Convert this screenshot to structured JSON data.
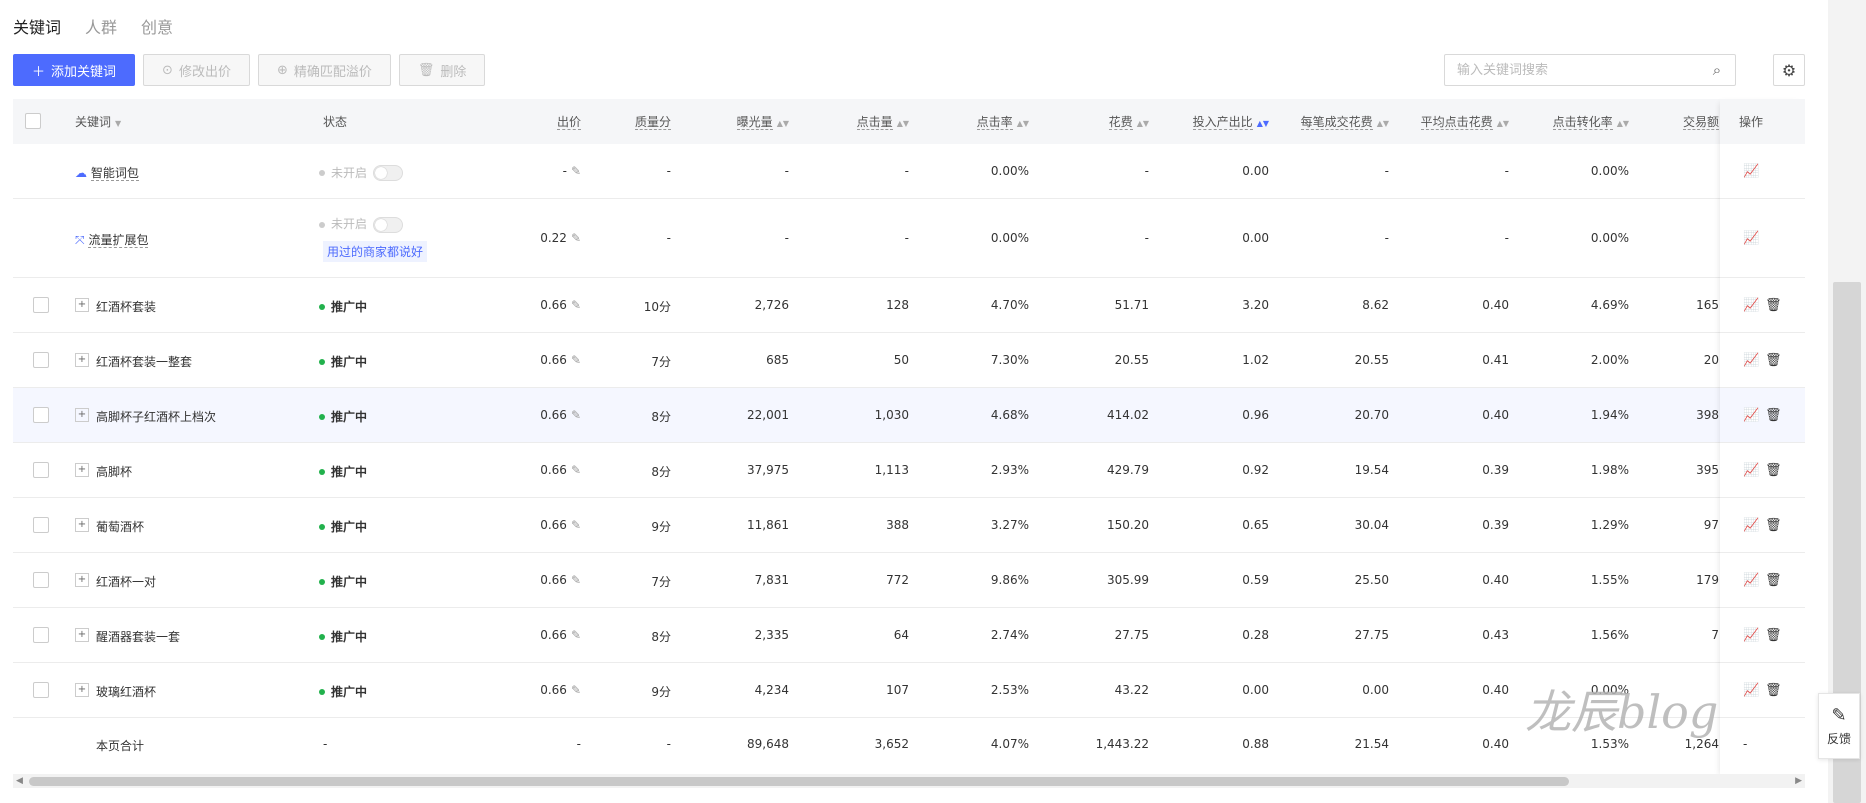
{
  "tabs": [
    "关键词",
    "人群",
    "创意"
  ],
  "toolbar": {
    "add_label": "添加关键词",
    "edit_bid_label": "修改出价",
    "exact_match_label": "精确匹配溢价",
    "delete_label": "删除"
  },
  "search": {
    "placeholder": "输入关键词搜索"
  },
  "headers": {
    "keyword": "关键词",
    "status": "状态",
    "bid": "出价",
    "quality": "质量分",
    "impressions": "曝光量",
    "clicks": "点击量",
    "ctr": "点击率",
    "cost": "花费",
    "roi": "投入产出比",
    "cost_per_order": "每笔成交花费",
    "avg_cpc": "平均点击花费",
    "cvr": "点击转化率",
    "gmv": "交易额",
    "ops": "操作"
  },
  "special_rows": [
    {
      "name": "智能词包",
      "status": "未开启",
      "bid": "-",
      "quality": "-",
      "impressions": "-",
      "clicks": "-",
      "ctr": "0.00%",
      "cost": "-",
      "roi": "0.00",
      "cost_per_order": "-",
      "avg_cpc": "-",
      "cvr": "0.00%"
    },
    {
      "name": "流量扩展包",
      "status": "未开启",
      "tip": "用过的商家都说好",
      "bid": "0.22",
      "quality": "-",
      "impressions": "-",
      "clicks": "-",
      "ctr": "0.00%",
      "cost": "-",
      "roi": "0.00",
      "cost_per_order": "-",
      "avg_cpc": "-",
      "cvr": "0.00%"
    }
  ],
  "rows": [
    {
      "keyword": "红酒杯套装",
      "status": "推广中",
      "bid": "0.66",
      "quality": "10分",
      "impressions": "2,726",
      "clicks": "128",
      "ctr": "4.70%",
      "cost": "51.71",
      "roi": "3.20",
      "cost_per_order": "8.62",
      "avg_cpc": "0.40",
      "cvr": "4.69%",
      "gmv": "165"
    },
    {
      "keyword": "红酒杯套装一整套",
      "status": "推广中",
      "bid": "0.66",
      "quality": "7分",
      "impressions": "685",
      "clicks": "50",
      "ctr": "7.30%",
      "cost": "20.55",
      "roi": "1.02",
      "cost_per_order": "20.55",
      "avg_cpc": "0.41",
      "cvr": "2.00%",
      "gmv": "20"
    },
    {
      "keyword": "高脚杯子红酒杯上档次",
      "status": "推广中",
      "bid": "0.66",
      "quality": "8分",
      "impressions": "22,001",
      "clicks": "1,030",
      "ctr": "4.68%",
      "cost": "414.02",
      "roi": "0.96",
      "cost_per_order": "20.70",
      "avg_cpc": "0.40",
      "cvr": "1.94%",
      "gmv": "398"
    },
    {
      "keyword": "高脚杯",
      "status": "推广中",
      "bid": "0.66",
      "quality": "8分",
      "impressions": "37,975",
      "clicks": "1,113",
      "ctr": "2.93%",
      "cost": "429.79",
      "roi": "0.92",
      "cost_per_order": "19.54",
      "avg_cpc": "0.39",
      "cvr": "1.98%",
      "gmv": "395"
    },
    {
      "keyword": "葡萄酒杯",
      "status": "推广中",
      "bid": "0.66",
      "quality": "9分",
      "impressions": "11,861",
      "clicks": "388",
      "ctr": "3.27%",
      "cost": "150.20",
      "roi": "0.65",
      "cost_per_order": "30.04",
      "avg_cpc": "0.39",
      "cvr": "1.29%",
      "gmv": "97"
    },
    {
      "keyword": "红酒杯一对",
      "status": "推广中",
      "bid": "0.66",
      "quality": "7分",
      "impressions": "7,831",
      "clicks": "772",
      "ctr": "9.86%",
      "cost": "305.99",
      "roi": "0.59",
      "cost_per_order": "25.50",
      "avg_cpc": "0.40",
      "cvr": "1.55%",
      "gmv": "179"
    },
    {
      "keyword": "醒酒器套装一套",
      "status": "推广中",
      "bid": "0.66",
      "quality": "8分",
      "impressions": "2,335",
      "clicks": "64",
      "ctr": "2.74%",
      "cost": "27.75",
      "roi": "0.28",
      "cost_per_order": "27.75",
      "avg_cpc": "0.43",
      "cvr": "1.56%",
      "gmv": "7"
    },
    {
      "keyword": "玻璃红酒杯",
      "status": "推广中",
      "bid": "0.66",
      "quality": "9分",
      "impressions": "4,234",
      "clicks": "107",
      "ctr": "2.53%",
      "cost": "43.22",
      "roi": "0.00",
      "cost_per_order": "0.00",
      "avg_cpc": "0.40",
      "cvr": "0.00%",
      "gmv": ""
    }
  ],
  "total": {
    "label": "本页合计",
    "status": "-",
    "bid": "-",
    "quality": "-",
    "impressions": "89,648",
    "clicks": "3,652",
    "ctr": "4.07%",
    "cost": "1,443.22",
    "roi": "0.88",
    "cost_per_order": "21.54",
    "avg_cpc": "0.40",
    "cvr": "1.53%",
    "gmv": "1,264",
    "ops": "-"
  },
  "feedback_label": "反馈",
  "watermark": "龙辰blog",
  "colors": {
    "accent": "#4d6bfe",
    "status_green": "#22b14c"
  }
}
